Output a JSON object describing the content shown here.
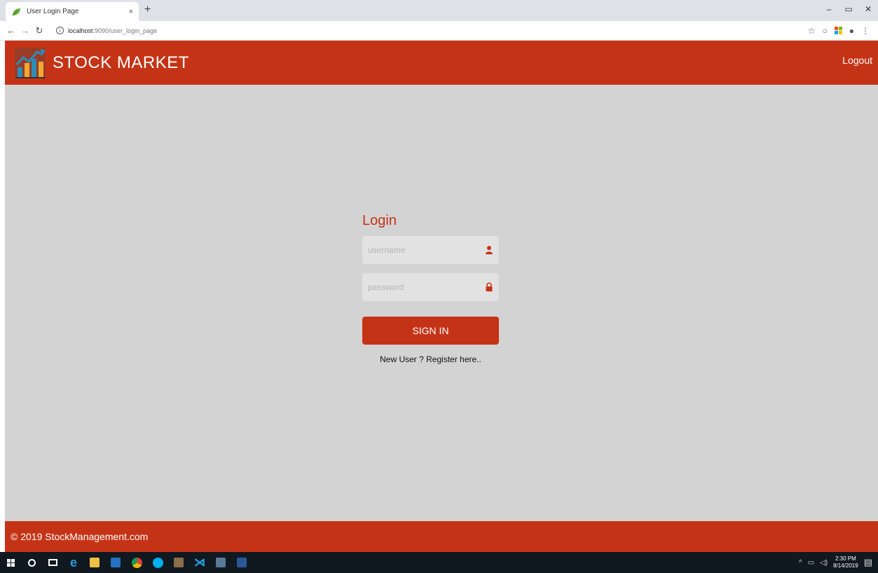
{
  "browser": {
    "tab_title": "User Login Page",
    "tab_close": "×",
    "new_tab": "+",
    "url_host": "localhost",
    "url_path": ":9090/user_login_page",
    "minimize": "–",
    "restore": "▭",
    "close": "✕"
  },
  "header": {
    "brand": "STOCK MARKET",
    "logout_label": "Logout"
  },
  "login": {
    "title": "Login",
    "username_placeholder": "username",
    "password_placeholder": "password",
    "signin_label": "SIGN IN",
    "register_label": "New User ? Register here.."
  },
  "footer": {
    "copyright": "© 2019 StockManagement.com"
  },
  "taskbar": {
    "time": "2:30 PM",
    "date": "8/14/2019"
  },
  "colors": {
    "brand_red": "#c53316",
    "page_bg": "#d3d3d3",
    "field_bg": "#e2e2e2"
  }
}
